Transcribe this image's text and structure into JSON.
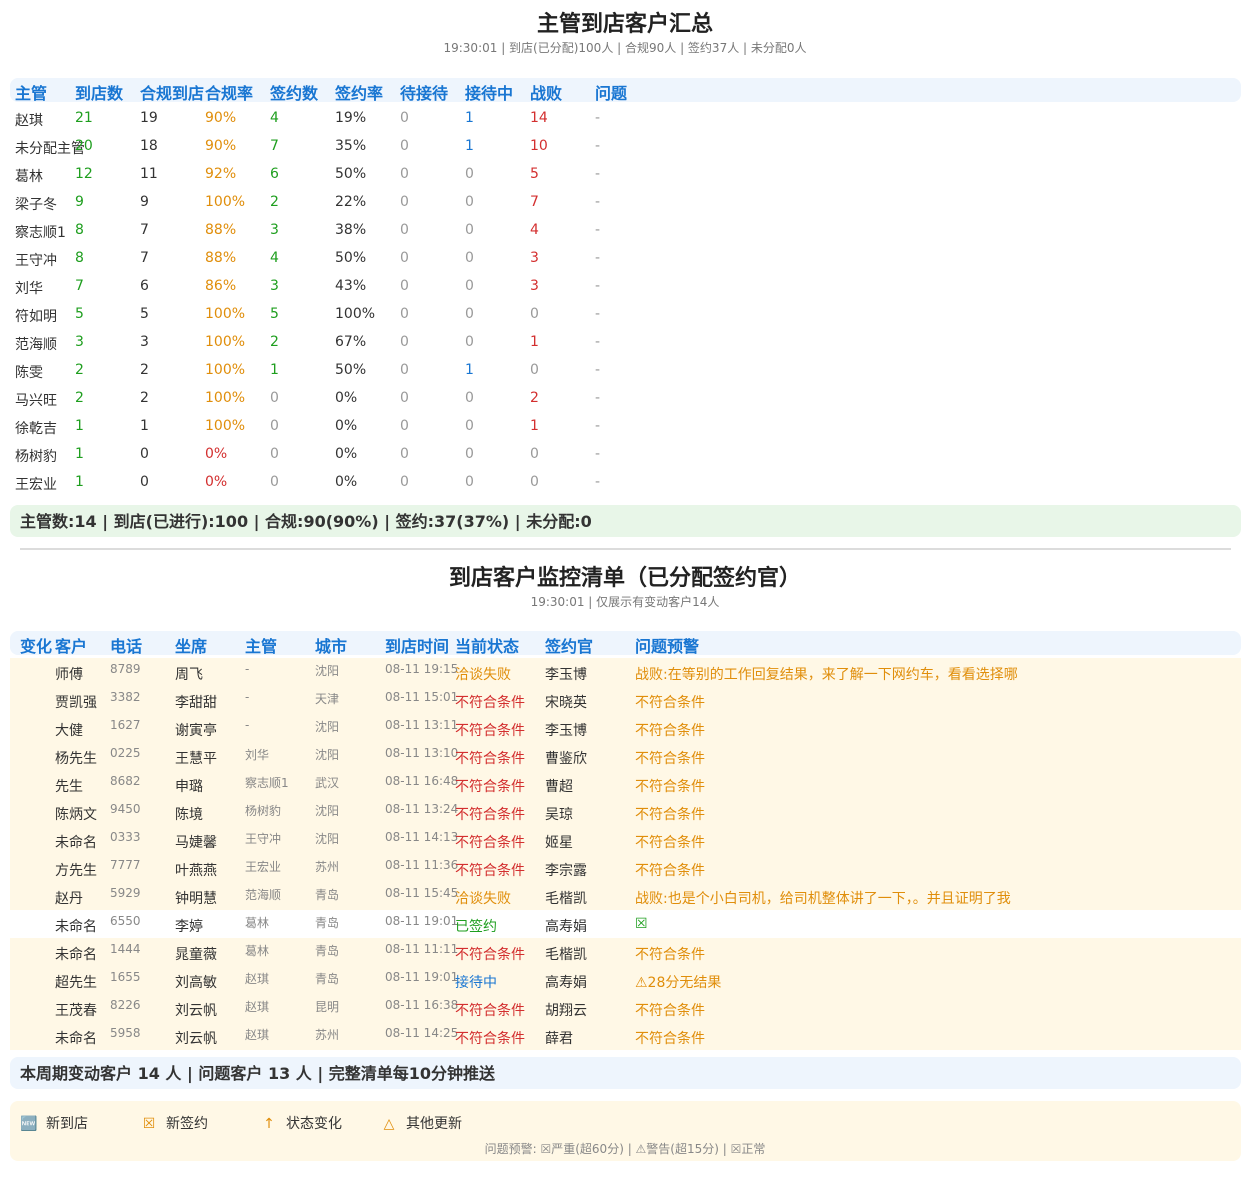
{
  "summary_section": {
    "title": "主管到店客户汇总",
    "subtitle": "19:30:01 | 到店(已分配)100人 | 合规90人 | 签约37人 | 未分配0人",
    "headers": [
      "主管",
      "到店数",
      "合规到店",
      "合规率",
      "签约数",
      "签约率",
      "待接待",
      "接待中",
      "战败",
      "问题"
    ],
    "rows": [
      [
        "赵琪",
        "21",
        "19",
        "90%",
        "4",
        "19%",
        "0",
        "1",
        "14",
        "-"
      ],
      [
        "未分配主管",
        "20",
        "18",
        "90%",
        "7",
        "35%",
        "0",
        "1",
        "10",
        "-"
      ],
      [
        "葛林",
        "12",
        "11",
        "92%",
        "6",
        "50%",
        "0",
        "0",
        "5",
        "-"
      ],
      [
        "梁子冬",
        "9",
        "9",
        "100%",
        "2",
        "22%",
        "0",
        "0",
        "7",
        "-"
      ],
      [
        "察志顺1",
        "8",
        "7",
        "88%",
        "3",
        "38%",
        "0",
        "0",
        "4",
        "-"
      ],
      [
        "王守冲",
        "8",
        "7",
        "88%",
        "4",
        "50%",
        "0",
        "0",
        "3",
        "-"
      ],
      [
        "刘华",
        "7",
        "6",
        "86%",
        "3",
        "43%",
        "0",
        "0",
        "3",
        "-"
      ],
      [
        "符如明",
        "5",
        "5",
        "100%",
        "5",
        "100%",
        "0",
        "0",
        "0",
        "-"
      ],
      [
        "范海顺",
        "3",
        "3",
        "100%",
        "2",
        "67%",
        "0",
        "0",
        "1",
        "-"
      ],
      [
        "陈雯",
        "2",
        "2",
        "100%",
        "1",
        "50%",
        "0",
        "1",
        "0",
        "-"
      ],
      [
        "马兴旺",
        "2",
        "2",
        "100%",
        "0",
        "0%",
        "0",
        "0",
        "2",
        "-"
      ],
      [
        "徐乾吉",
        "1",
        "1",
        "100%",
        "0",
        "0%",
        "0",
        "0",
        "1",
        "-"
      ],
      [
        "杨树豹",
        "1",
        "0",
        "0%",
        "0",
        "0%",
        "0",
        "0",
        "0",
        "-"
      ],
      [
        "王宏业",
        "1",
        "0",
        "0%",
        "0",
        "0%",
        "0",
        "0",
        "0",
        "-"
      ]
    ],
    "footer": "主管数:14 | 到店(已进行):100 | 合规:90(90%) | 签约:37(37%) | 未分配:0"
  },
  "monitor_section": {
    "title": "到店客户监控清单（已分配签约官）",
    "subtitle": "19:30:01 | 仅展示有变动客户14人",
    "headers": [
      "变化",
      "客户",
      "电话",
      "坐席",
      "主管",
      "城市",
      "到店时间",
      "当前状态",
      "签约官",
      "问题预警"
    ],
    "rows": [
      {
        "change": "",
        "customer": "师傅",
        "phone": "8789",
        "agent": "周飞",
        "supervisor": "-",
        "city": "沈阳",
        "time": "08-11 19:15",
        "status": "洽谈失败",
        "signer": "李玉博",
        "alert": "战败:在等别的工作回复结果，来了解一下网约车，看看选择哪"
      },
      {
        "change": "",
        "customer": "贾凯强",
        "phone": "3382",
        "agent": "李甜甜",
        "supervisor": "-",
        "city": "天津",
        "time": "08-11 15:01",
        "status": "不符合条件",
        "signer": "宋晓英",
        "alert": "不符合条件"
      },
      {
        "change": "",
        "customer": "大健",
        "phone": "1627",
        "agent": "谢寅亭",
        "supervisor": "-",
        "city": "沈阳",
        "time": "08-11 13:11",
        "status": "不符合条件",
        "signer": "李玉博",
        "alert": "不符合条件"
      },
      {
        "change": "",
        "customer": "杨先生",
        "phone": "0225",
        "agent": "王慧平",
        "supervisor": "刘华",
        "city": "沈阳",
        "time": "08-11 13:10",
        "status": "不符合条件",
        "signer": "曹鉴欣",
        "alert": "不符合条件"
      },
      {
        "change": "",
        "customer": "先生",
        "phone": "8682",
        "agent": "申璐",
        "supervisor": "察志顺1",
        "city": "武汉",
        "time": "08-11 16:48",
        "status": "不符合条件",
        "signer": "曹超",
        "alert": "不符合条件"
      },
      {
        "change": "",
        "customer": "陈炳文",
        "phone": "9450",
        "agent": "陈境",
        "supervisor": "杨树豹",
        "city": "沈阳",
        "time": "08-11 13:24",
        "status": "不符合条件",
        "signer": "吴琼",
        "alert": "不符合条件"
      },
      {
        "change": "",
        "customer": "未命名",
        "phone": "0333",
        "agent": "马婕馨",
        "supervisor": "王守冲",
        "city": "沈阳",
        "time": "08-11 14:13",
        "status": "不符合条件",
        "signer": "姬星",
        "alert": "不符合条件"
      },
      {
        "change": "",
        "customer": "方先生",
        "phone": "7777",
        "agent": "叶燕燕",
        "supervisor": "王宏业",
        "city": "苏州",
        "time": "08-11 11:36",
        "status": "不符合条件",
        "signer": "李宗露",
        "alert": "不符合条件"
      },
      {
        "change": "",
        "customer": "赵丹",
        "phone": "5929",
        "agent": "钟明慧",
        "supervisor": "范海顺",
        "city": "青岛",
        "time": "08-11 15:45",
        "status": "洽谈失败",
        "signer": "毛楷凯",
        "alert": "战败:也是个小白司机，给司机整体讲了一下，。并且证明了我"
      },
      {
        "change": "",
        "customer": "未命名",
        "phone": "6550",
        "agent": "李婷",
        "supervisor": "葛林",
        "city": "青岛",
        "time": "08-11 19:01",
        "status": "已签约",
        "signer": "高寿娟",
        "alert": "☒"
      },
      {
        "change": "",
        "customer": "未命名",
        "phone": "1444",
        "agent": "晁童薇",
        "supervisor": "葛林",
        "city": "青岛",
        "time": "08-11 11:11",
        "status": "不符合条件",
        "signer": "毛楷凯",
        "alert": "不符合条件"
      },
      {
        "change": "",
        "customer": "超先生",
        "phone": "1655",
        "agent": "刘高敏",
        "supervisor": "赵琪",
        "city": "青岛",
        "time": "08-11 19:01",
        "status": "接待中",
        "signer": "高寿娟",
        "alert": "⚠28分无结果"
      },
      {
        "change": "",
        "customer": "王茂春",
        "phone": "8226",
        "agent": "刘云帆",
        "supervisor": "赵琪",
        "city": "昆明",
        "time": "08-11 16:38",
        "status": "不符合条件",
        "signer": "胡翔云",
        "alert": "不符合条件"
      },
      {
        "change": "",
        "customer": "未命名",
        "phone": "5958",
        "agent": "刘云帆",
        "supervisor": "赵琪",
        "city": "苏州",
        "time": "08-11 14:25",
        "status": "不符合条件",
        "signer": "薛君",
        "alert": "不符合条件"
      }
    ],
    "footer": "本周期变动客户 14 人 | 问题客户 13 人 | 完整清单每10分钟推送"
  },
  "legend": {
    "items": [
      {
        "icon": "🆕",
        "label": "新到店",
        "color": "#e08e0b"
      },
      {
        "icon": "☒",
        "label": "新签约",
        "color": "#e08e0b"
      },
      {
        "icon": "↑",
        "label": "状态变化",
        "color": "#e08e0b"
      },
      {
        "icon": "△",
        "label": "其他更新",
        "color": "#e08e0b"
      }
    ],
    "note": "问题预警: ☒严重(超60分) | ⚠警告(超15分) | ☒正常"
  },
  "colors": {
    "header_blue": "#1976d2",
    "good_green": "#1e9e1e",
    "warn_orange": "#e08e0b",
    "bad_red": "#d32f2f",
    "summary_bg": "#e8f6e8",
    "footer_bg": "#eef5fd",
    "row_highlight": "#fff8e6"
  }
}
